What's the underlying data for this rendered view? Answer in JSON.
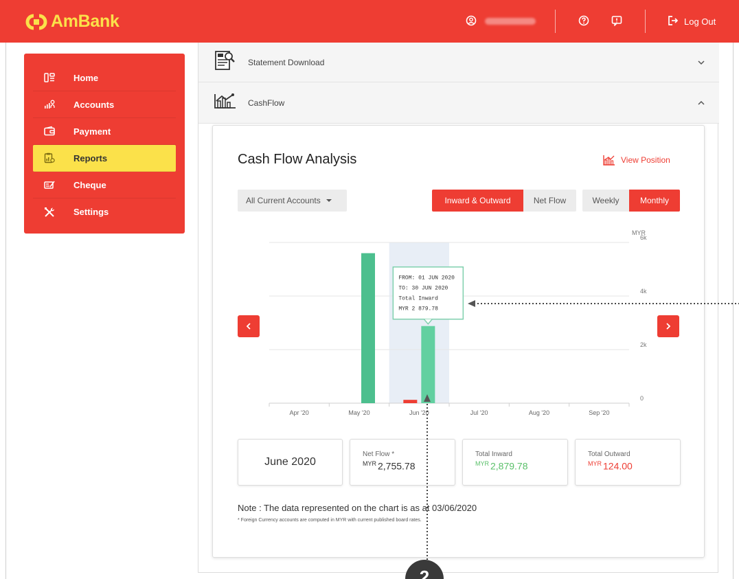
{
  "brand": {
    "name": "AmBank",
    "primary": "#ee3d33",
    "accent": "#fbe14a"
  },
  "header": {
    "logout_label": "Log Out",
    "icons": [
      "user-icon",
      "help-icon",
      "feedback-icon",
      "logout-icon"
    ]
  },
  "sidebar": {
    "items": [
      {
        "label": "Home",
        "icon": "home-icon"
      },
      {
        "label": "Accounts",
        "icon": "accounts-icon"
      },
      {
        "label": "Payment",
        "icon": "wallet-icon"
      },
      {
        "label": "Reports",
        "icon": "reports-icon",
        "active": true
      },
      {
        "label": "Cheque",
        "icon": "cheque-icon"
      },
      {
        "label": "Settings",
        "icon": "tools-icon"
      }
    ]
  },
  "accordion": {
    "statement_label": "Statement Download",
    "cashflow_label": "CashFlow"
  },
  "card": {
    "title": "Cash Flow Analysis",
    "view_position_label": "View Position",
    "account_select": "All Current Accounts",
    "flow_toggle": {
      "inward_outward": "Inward & Outward",
      "net_flow": "Net Flow"
    },
    "period_toggle": {
      "weekly": "Weekly",
      "monthly": "Monthly"
    }
  },
  "chart_data": {
    "type": "bar",
    "categories": [
      "Apr '20",
      "May '20",
      "Jun '20",
      "Jul '20",
      "Aug '20",
      "Sep '20"
    ],
    "series": [
      {
        "name": "Total Inward",
        "color": "#4cbf8e",
        "values": [
          0,
          5600,
          2879.78,
          0,
          0,
          0
        ]
      },
      {
        "name": "Total Outward",
        "color": "#ee3d33",
        "values": [
          0,
          0,
          124,
          0,
          0,
          0
        ]
      }
    ],
    "ylabel": "MYR",
    "ylim": [
      0,
      6000
    ],
    "yticks": [
      "0",
      "2k",
      "4k",
      "6k"
    ],
    "highlight_category": "Jun '20",
    "tooltip": [
      "FROM: 01 JUN 2020",
      "TO: 30 JUN 2020",
      "Total Inward",
      "MYR 2 879.78"
    ]
  },
  "summary": {
    "month": "June 2020",
    "net_flow_caption": "Net Flow *",
    "net_flow_currency": "MYR",
    "net_flow_value": "2,755.78",
    "inward_caption": "Total Inward",
    "inward_currency": "MYR",
    "inward_value": "2,879.78",
    "outward_caption": "Total Outward",
    "outward_currency": "MYR",
    "outward_value": "124.00"
  },
  "note": {
    "line1": "Note : The data represented on the chart is as at 03/06/2020",
    "line2": "* Foreign Currency accounts are computed in MYR with current published board rates."
  },
  "annotation": {
    "badge": "2"
  }
}
